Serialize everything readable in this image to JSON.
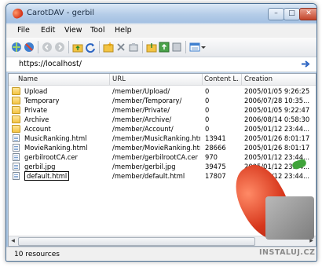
{
  "window": {
    "title": "CarotDAV - gerbil"
  },
  "menu": [
    "File",
    "Edit",
    "View",
    "Tool",
    "Help"
  ],
  "address": {
    "value": "https://localhost/"
  },
  "columns": [
    "Name",
    "URL",
    "Content L...",
    "Creation"
  ],
  "rows": [
    {
      "name": "Upload",
      "url": "/member/Upload/",
      "length": "0",
      "creation": "2005/01/05 9:26:25",
      "kind": "folder"
    },
    {
      "name": "Temporary",
      "url": "/member/Temporary/",
      "length": "0",
      "creation": "2006/07/28 10:35...",
      "kind": "folder"
    },
    {
      "name": "Private",
      "url": "/member/Private/",
      "length": "0",
      "creation": "2005/01/05 9:22:47",
      "kind": "folder"
    },
    {
      "name": "Archive",
      "url": "/member/Archive/",
      "length": "0",
      "creation": "2006/08/14 0:58:30",
      "kind": "folder"
    },
    {
      "name": "Account",
      "url": "/member/Account/",
      "length": "0",
      "creation": "2005/01/12 23:44...",
      "kind": "folder"
    },
    {
      "name": "MusicRanking.html",
      "url": "/member/MusicRanking.html",
      "length": "13941",
      "creation": "2005/01/26 8:01:17",
      "kind": "file"
    },
    {
      "name": "MovieRanking.html",
      "url": "/member/MovieRanking.html",
      "length": "28666",
      "creation": "2005/01/26 8:01:17",
      "kind": "file"
    },
    {
      "name": "gerbilrootCA.cer",
      "url": "/member/gerbilrootCA.cer",
      "length": "970",
      "creation": "2005/01/12 23:44...",
      "kind": "file"
    },
    {
      "name": "gerbil.jpg",
      "url": "/member/gerbil.jpg",
      "length": "39475",
      "creation": "2005/01/12 23:44...",
      "kind": "file"
    },
    {
      "name": "default.html",
      "url": "/member/default.html",
      "length": "17807",
      "creation": "2005/01/12 23:44...",
      "kind": "file",
      "editing": true
    }
  ],
  "status": {
    "text": "10 resources"
  },
  "watermark": {
    "text": "INSTALUJ.CZ"
  },
  "icons": {
    "app": "carrot-icon",
    "toolbar": [
      "connect-icon",
      "disconnect-icon",
      "back-icon",
      "forward-icon",
      "up-folder-icon",
      "refresh-icon",
      "new-folder-icon",
      "delete-icon",
      "properties-icon",
      "download-icon",
      "upload-icon",
      "sync-icon",
      "view-icon"
    ],
    "go": "go-arrow-icon"
  },
  "colors": {
    "titlebar": "#b5cde8",
    "folder": "#f3c443",
    "accent": "#3b78d8"
  }
}
